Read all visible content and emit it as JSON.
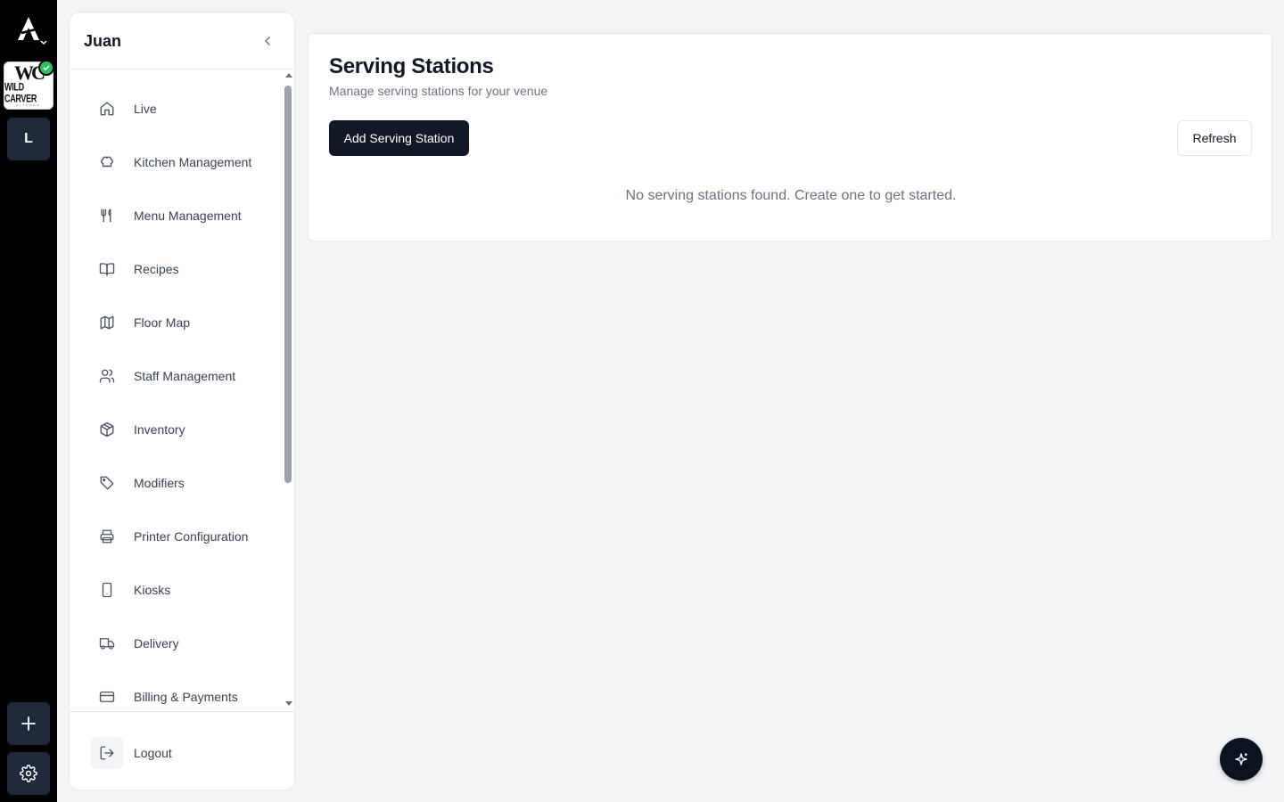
{
  "app": {
    "rail": {
      "venue": {
        "monogram": "WC",
        "name": "WILD CARVER",
        "tagline": "KITCHEN"
      },
      "venue_initial": "L"
    }
  },
  "sidebar": {
    "title": "Juan",
    "items": [
      {
        "label": "Live",
        "icon": "home-icon"
      },
      {
        "label": "Kitchen Management",
        "icon": "chef-hat-icon"
      },
      {
        "label": "Menu Management",
        "icon": "utensils-icon"
      },
      {
        "label": "Recipes",
        "icon": "book-open-icon"
      },
      {
        "label": "Floor Map",
        "icon": "map-icon"
      },
      {
        "label": "Staff Management",
        "icon": "users-icon"
      },
      {
        "label": "Inventory",
        "icon": "package-icon"
      },
      {
        "label": "Modifiers",
        "icon": "tag-icon"
      },
      {
        "label": "Printer Configuration",
        "icon": "printer-icon"
      },
      {
        "label": "Kiosks",
        "icon": "tablet-icon"
      },
      {
        "label": "Delivery",
        "icon": "truck-icon"
      },
      {
        "label": "Billing & Payments",
        "icon": "credit-card-icon"
      }
    ],
    "logout_label": "Logout"
  },
  "main": {
    "title": "Serving Stations",
    "subtitle": "Manage serving stations for your venue",
    "add_button": "Add Serving Station",
    "refresh_button": "Refresh",
    "empty_message": "No serving stations found. Create one to get started."
  },
  "colors": {
    "rail_bg": "#000000",
    "primary_button": "#111827",
    "status_online": "#22c55e",
    "page_bg": "#f3f4f6"
  }
}
